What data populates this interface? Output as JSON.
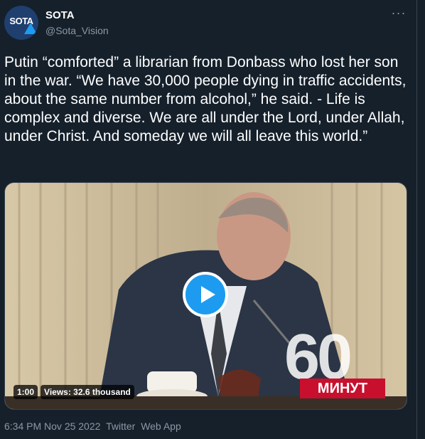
{
  "author": {
    "name": "SOTA",
    "handle": "@Sota_Vision",
    "avatar_text": "SOTA"
  },
  "tweet": {
    "text": "Putin “comforted” a librarian from Donbass who lost her son in the war. “We have 30,000 people dying in traffic accidents, about the same number from alcohol,” he said. - Life is complex and diverse. We are all under the Lord, under Allah, under Christ. And someday we will all leave this world.”",
    "more_icon": "more-dots-icon"
  },
  "video": {
    "duration": "1:00",
    "views": "Views: 32.6 thousand",
    "watermark_number": "60",
    "watermark_label": "МИНУТ",
    "play_icon": "play-icon"
  },
  "meta": {
    "time": "6:34 PM Nov 25 2022",
    "source1": "Twitter",
    "source2": "Web App"
  },
  "colors": {
    "background": "#15202b",
    "accent": "#1d9bf0",
    "secondary_text": "#8b98a5"
  }
}
